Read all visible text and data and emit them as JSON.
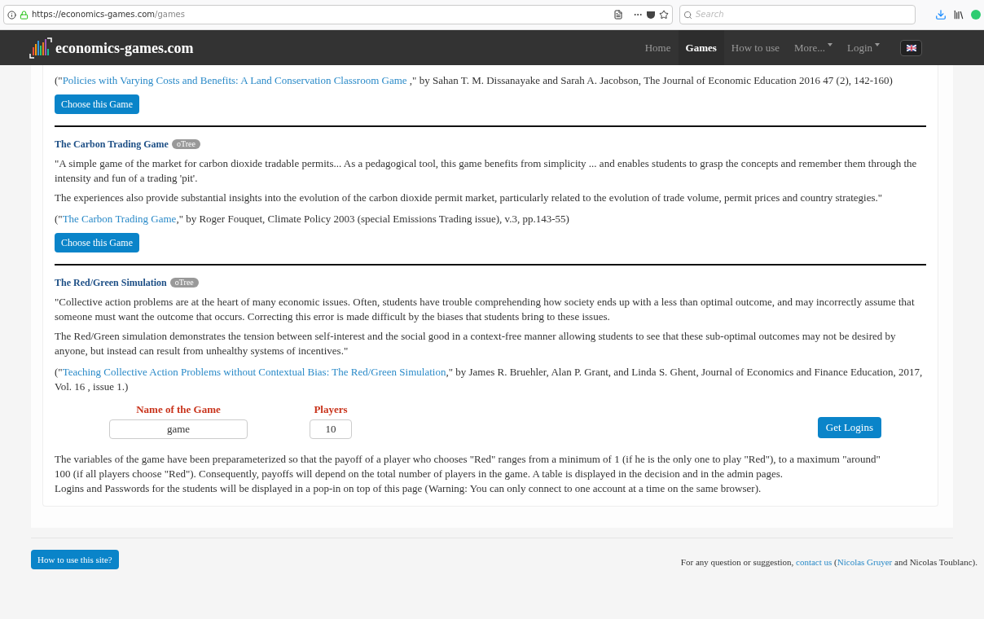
{
  "browser": {
    "url_host": "https://economics-games.com",
    "url_path": "/games",
    "search_placeholder": "Search"
  },
  "navbar": {
    "brand": "economics-games.com",
    "items": [
      {
        "label": "Home",
        "selected": false,
        "dropdown": false
      },
      {
        "label": "Games",
        "selected": true,
        "dropdown": false
      },
      {
        "label": "How to use",
        "selected": false,
        "dropdown": false
      },
      {
        "label": "More...",
        "selected": false,
        "dropdown": true
      },
      {
        "label": "Login",
        "selected": false,
        "dropdown": true
      }
    ]
  },
  "games": [
    {
      "citation": {
        "before": "(\"",
        "link": "Policies with Varying Costs and Benefits: A Land Conservation Classroom Game ",
        "after": ",\" by Sahan T. M. Dissanayake and Sarah A. Jacobson, The Journal of Economic Education 2016 47 (2), 142-160)"
      },
      "button": "Choose this Game"
    },
    {
      "title": "The Carbon Trading Game",
      "badge": "oTree",
      "paragraphs": [
        "\"A simple game of the market for carbon dioxide tradable permits... As a pedagogical tool, this game benefits from simplicity ... and enables students to grasp the concepts and remember them through the intensity and fun of a trading 'pit'.",
        "The experiences also provide substantial insights into the evolution of the carbon dioxide permit market, particularly related to the evolution of trade volume, permit prices and country strategies.\""
      ],
      "citation": {
        "before": "(\"",
        "link": "The Carbon Trading Game",
        "after": ",\" by Roger Fouquet, Climate Policy 2003 (special Emissions Trading issue), v.3, pp.143-55)"
      },
      "button": "Choose this Game"
    },
    {
      "title": "The Red/Green Simulation",
      "badge": "oTree",
      "paragraphs": [
        "\"Collective action problems are at the heart of many economic issues. Often, students have trouble comprehending how society ends up with a less than optimal outcome, and may incorrectly assume that someone must want the outcome that occurs. Correcting this error is made difficult by the biases that students bring to these issues.",
        "The Red/Green simulation demonstrates the tension between self-interest and the social good in a context-free manner allowing students to see that these sub-optimal outcomes may not be desired by anyone, but instead can result from unhealthy systems of incentives.\""
      ],
      "citation": {
        "before": "(\"",
        "link": "Teaching Collective Action Problems without Contextual Bias: The Red/Green Simulation",
        "after": ",\" by James R. Bruehler, Alan P. Grant, and Linda S. Ghent, Journal of Economics and Finance Education, 2017, Vol. 16 , issue 1.)"
      }
    }
  ],
  "form": {
    "fields": [
      {
        "label": "Name of the Game",
        "value": "game"
      },
      {
        "label": "Players",
        "value": "10"
      }
    ],
    "button": "Get Logins",
    "notes": [
      "The variables of the game have been preparameterized so that the payoff of a player who chooses \"Red\" ranges from a minimum of 1 (if he is the only one to play \"Red\"), to a maximum \"around\" 100 (if all players choose \"Red\"). Consequently, payoffs will depend on the total number of players in the game. A table is displayed in the decision and in the admin pages.",
      "Logins and Passwords for the students will be displayed in a pop-in on top of this page (Warning: You can only connect to one account at a time on the same browser)."
    ]
  },
  "footer": {
    "help_button": "How to use this site?",
    "contact": {
      "before": "For any question or suggestion,",
      "link": "contact us",
      "paren_open": "(",
      "author_link": "Nicolas Gruyer",
      "after": "and Nicolas Toublanc)."
    }
  }
}
